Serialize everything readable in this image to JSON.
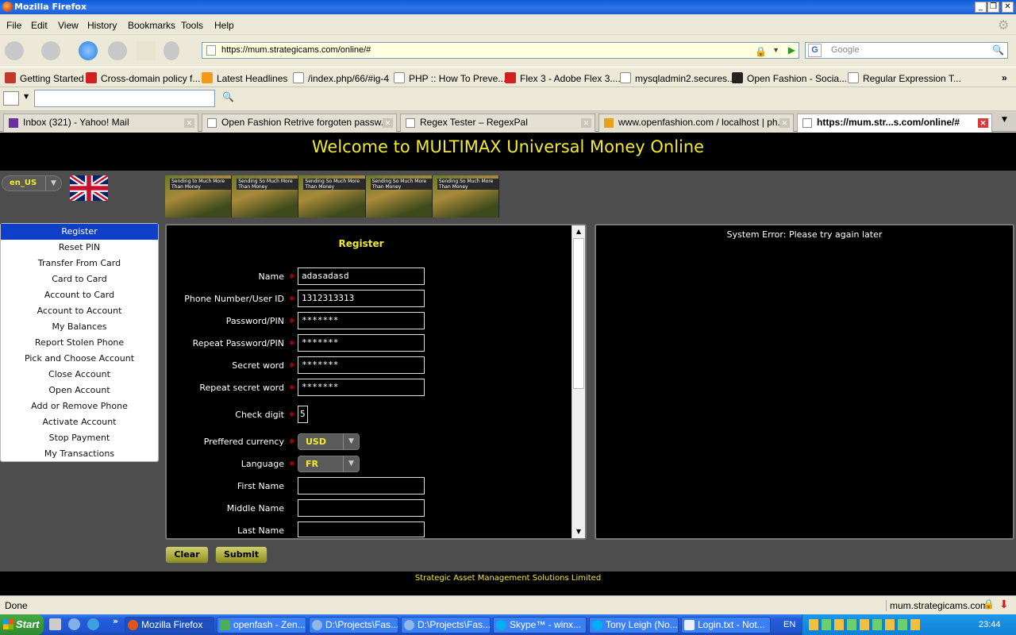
{
  "window": {
    "title": "Mozilla Firefox"
  },
  "menu": [
    "File",
    "Edit",
    "View",
    "History",
    "Bookmarks",
    "Tools",
    "Help"
  ],
  "nav": {
    "url": "https://mum.strategicams.com/online/#",
    "search_placeholder": "Google"
  },
  "bookmarks": [
    "Getting Started",
    "Cross-domain policy f...",
    "Latest Headlines",
    "/index.php/66/#ig-4",
    "PHP :: How To Preve...",
    "Flex 3 - Adobe Flex 3....",
    "mysqladmin2.secures...",
    "Open Fashion - Socia...",
    "Regular Expression T..."
  ],
  "tabs": [
    {
      "label": "Inbox (321) - Yahoo! Mail"
    },
    {
      "label": "Open Fashion Retrive forgoten passw..."
    },
    {
      "label": "Regex Tester – RegexPal"
    },
    {
      "label": "www.openfashion.com / localhost | ph..."
    },
    {
      "label": "https://mum.str...s.com/online/#"
    }
  ],
  "page": {
    "header": "Welcome to MULTIMAX Universal Money Online",
    "locale": "en_US",
    "banner_texts": [
      "Sending to Much More Than Money",
      "Sending So Much More Than Money",
      "Sending So Much More Than Money",
      "Sending So Much More Than Money",
      "Sending So Much More Than Money"
    ],
    "sidebar": [
      "Register",
      "Reset PIN",
      "Transfer From Card",
      "Card to Card",
      "Account to Card",
      "Account to Account",
      "My Balances",
      "Report Stolen Phone",
      "Pick and Choose Account",
      "Close Account",
      "Open Account",
      "Add or Remove Phone",
      "Activate Account",
      "Stop Payment",
      "My Transactions"
    ],
    "form": {
      "title": "Register",
      "fields": [
        {
          "label": "Name",
          "value": "adasadasd"
        },
        {
          "label": "Phone Number/User ID",
          "value": "1312313313"
        },
        {
          "label": "Password/PIN",
          "value": "*******"
        },
        {
          "label": "Repeat Password/PIN",
          "value": "*******"
        },
        {
          "label": "Secret word",
          "value": "*******"
        },
        {
          "label": "Repeat secret word",
          "value": "*******"
        },
        {
          "label": "Check digit",
          "value": "5"
        },
        {
          "label": "Preffered currency",
          "value": "USD"
        },
        {
          "label": "Language",
          "value": "FR"
        },
        {
          "label": "First Name",
          "value": ""
        },
        {
          "label": "Middle Name",
          "value": ""
        },
        {
          "label": "Last Name",
          "value": ""
        }
      ],
      "clear_label": "Clear",
      "submit_label": "Submit"
    },
    "error": "System Error: Please try again later",
    "footer": "Strategic Asset Management Solutions Limited"
  },
  "status": {
    "text": "Done",
    "domain": "mum.strategicams.com"
  },
  "taskbar": {
    "start": "Start",
    "tasks": [
      "Mozilla Firefox",
      "openfash - Zen...",
      "D:\\Projects\\Fas...",
      "D:\\Projects\\Fas...",
      "Skype™ - winx...",
      "Tony Leigh (No...",
      "Login.txt - Not..."
    ],
    "lang": "EN",
    "clock": "23:44"
  },
  "colors": {
    "accent_yellow": "#f2ea2e",
    "sidebar_active": "#0f3fc6",
    "page_bg": "#4d4d4d"
  }
}
